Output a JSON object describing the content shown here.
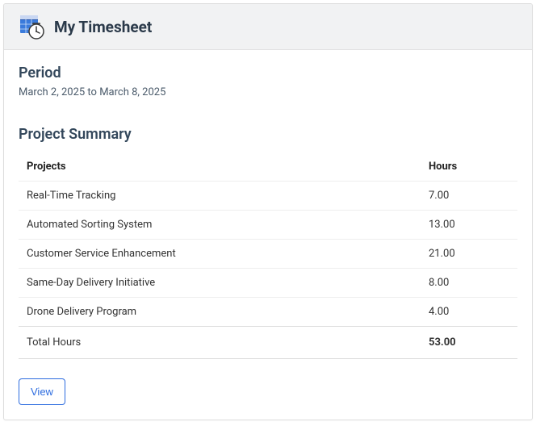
{
  "header": {
    "title": "My Timesheet"
  },
  "period": {
    "label": "Period",
    "range": "March 2, 2025 to March 8, 2025"
  },
  "summary": {
    "title": "Project Summary",
    "columns": {
      "projects": "Projects",
      "hours": "Hours"
    },
    "rows": [
      {
        "project": "Real-Time Tracking",
        "hours": "7.00"
      },
      {
        "project": "Automated Sorting System",
        "hours": "13.00"
      },
      {
        "project": "Customer Service Enhancement",
        "hours": "21.00"
      },
      {
        "project": "Same-Day Delivery Initiative",
        "hours": "8.00"
      },
      {
        "project": "Drone Delivery Program",
        "hours": "4.00"
      }
    ],
    "total": {
      "label": "Total Hours",
      "hours": "53.00"
    }
  },
  "actions": {
    "view": "View"
  }
}
